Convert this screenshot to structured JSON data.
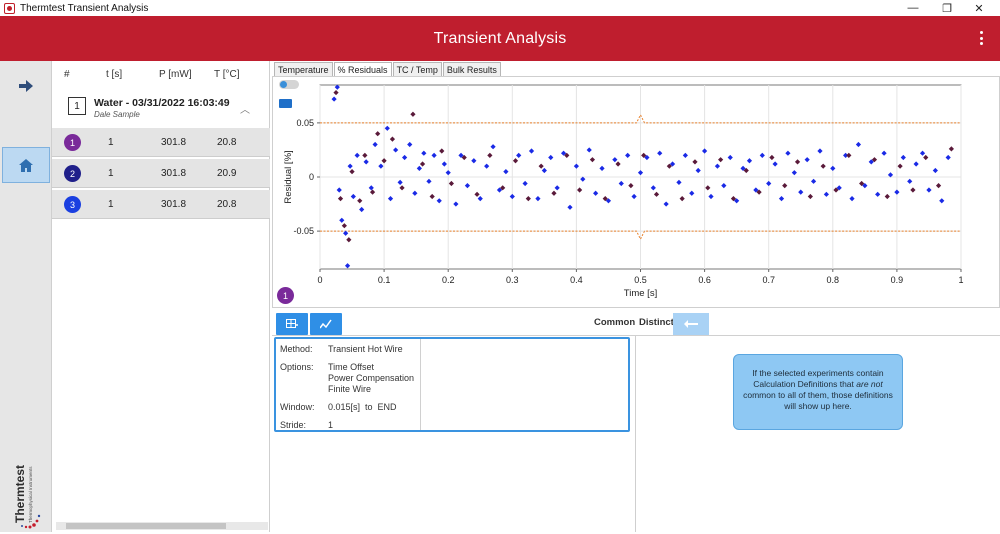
{
  "window": {
    "title": "Thermtest Transient Analysis",
    "minimize": "—",
    "maximize": "❐",
    "close": "✕"
  },
  "header": {
    "title": "Transient Analysis"
  },
  "rail": {
    "arrow_icon": "arrow-right-icon",
    "home_icon": "home-icon"
  },
  "brand": {
    "name": "Thermtest",
    "tagline": "Thermophysical Instruments"
  },
  "experiments": {
    "columns": [
      "#",
      "t [s]",
      "P [mW]",
      "T [°C]"
    ],
    "group": {
      "number": "1",
      "name": "Water - 03/31/2022 16:03:49",
      "sample": "Dale Sample"
    },
    "rows": [
      {
        "num": "1",
        "t": "1",
        "p": "301.8",
        "temp": "20.8",
        "color": "#7a2a9a"
      },
      {
        "num": "2",
        "t": "1",
        "p": "301.8",
        "temp": "20.9",
        "color": "#1f1f8a"
      },
      {
        "num": "3",
        "t": "1",
        "p": "301.8",
        "temp": "20.8",
        "color": "#1a3fe0"
      }
    ]
  },
  "tabs": [
    "Temperature",
    "% Residuals",
    "TC / Temp",
    "Bulk Results"
  ],
  "active_tab": "% Residuals",
  "chart_badge": "1",
  "chart_data": {
    "type": "scatter",
    "xlabel": "Time [s]",
    "ylabel": "Residual [%]",
    "xlim": [
      0,
      1
    ],
    "ylim": [
      -0.085,
      0.085
    ],
    "xticks": [
      "0",
      "0.1",
      "0.2",
      "0.3",
      "0.4",
      "0.5",
      "0.6",
      "0.7",
      "0.8",
      "0.9",
      "1"
    ],
    "yticks": [
      "0.05",
      "0",
      "-0.05"
    ],
    "grid": true,
    "limit_lines": [
      0.05,
      -0.05
    ],
    "series": [
      {
        "color": "#1a2ae6",
        "points": [
          [
            0.022,
            0.072
          ],
          [
            0.027,
            0.083
          ],
          [
            0.03,
            -0.012
          ],
          [
            0.034,
            -0.04
          ],
          [
            0.04,
            -0.052
          ],
          [
            0.043,
            -0.082
          ],
          [
            0.047,
            0.01
          ],
          [
            0.052,
            -0.018
          ],
          [
            0.058,
            0.02
          ],
          [
            0.065,
            -0.03
          ],
          [
            0.072,
            0.014
          ],
          [
            0.08,
            -0.01
          ],
          [
            0.086,
            0.03
          ],
          [
            0.095,
            0.01
          ],
          [
            0.105,
            0.045
          ],
          [
            0.11,
            -0.02
          ],
          [
            0.118,
            0.025
          ],
          [
            0.125,
            -0.005
          ],
          [
            0.132,
            0.018
          ],
          [
            0.14,
            0.03
          ],
          [
            0.148,
            -0.015
          ],
          [
            0.155,
            0.008
          ],
          [
            0.162,
            0.022
          ],
          [
            0.17,
            -0.004
          ],
          [
            0.178,
            0.02
          ],
          [
            0.186,
            -0.022
          ],
          [
            0.194,
            0.012
          ],
          [
            0.2,
            0.004
          ],
          [
            0.212,
            -0.025
          ],
          [
            0.22,
            0.02
          ],
          [
            0.23,
            -0.008
          ],
          [
            0.24,
            0.015
          ],
          [
            0.25,
            -0.02
          ],
          [
            0.26,
            0.01
          ],
          [
            0.27,
            0.028
          ],
          [
            0.28,
            -0.012
          ],
          [
            0.29,
            0.005
          ],
          [
            0.3,
            -0.018
          ],
          [
            0.31,
            0.02
          ],
          [
            0.32,
            -0.006
          ],
          [
            0.33,
            0.024
          ],
          [
            0.34,
            -0.02
          ],
          [
            0.35,
            0.006
          ],
          [
            0.36,
            0.018
          ],
          [
            0.37,
            -0.01
          ],
          [
            0.38,
            0.022
          ],
          [
            0.39,
            -0.028
          ],
          [
            0.4,
            0.01
          ],
          [
            0.41,
            -0.002
          ],
          [
            0.42,
            0.025
          ],
          [
            0.43,
            -0.015
          ],
          [
            0.44,
            0.008
          ],
          [
            0.45,
            -0.022
          ],
          [
            0.46,
            0.016
          ],
          [
            0.47,
            -0.006
          ],
          [
            0.48,
            0.02
          ],
          [
            0.49,
            -0.018
          ],
          [
            0.5,
            0.004
          ],
          [
            0.51,
            0.018
          ],
          [
            0.52,
            -0.01
          ],
          [
            0.53,
            0.022
          ],
          [
            0.54,
            -0.025
          ],
          [
            0.55,
            0.012
          ],
          [
            0.56,
            -0.005
          ],
          [
            0.57,
            0.02
          ],
          [
            0.58,
            -0.015
          ],
          [
            0.59,
            0.006
          ],
          [
            0.6,
            0.024
          ],
          [
            0.61,
            -0.018
          ],
          [
            0.62,
            0.01
          ],
          [
            0.63,
            -0.008
          ],
          [
            0.64,
            0.018
          ],
          [
            0.65,
            -0.022
          ],
          [
            0.66,
            0.008
          ],
          [
            0.67,
            0.015
          ],
          [
            0.68,
            -0.012
          ],
          [
            0.69,
            0.02
          ],
          [
            0.7,
            -0.006
          ],
          [
            0.71,
            0.012
          ],
          [
            0.72,
            -0.02
          ],
          [
            0.73,
            0.022
          ],
          [
            0.74,
            0.004
          ],
          [
            0.75,
            -0.014
          ],
          [
            0.76,
            0.016
          ],
          [
            0.77,
            -0.004
          ],
          [
            0.78,
            0.024
          ],
          [
            0.79,
            -0.016
          ],
          [
            0.8,
            0.008
          ],
          [
            0.81,
            -0.01
          ],
          [
            0.82,
            0.02
          ],
          [
            0.83,
            -0.02
          ],
          [
            0.84,
            0.03
          ],
          [
            0.85,
            -0.008
          ],
          [
            0.86,
            0.014
          ],
          [
            0.87,
            -0.016
          ],
          [
            0.88,
            0.022
          ],
          [
            0.89,
            0.002
          ],
          [
            0.9,
            -0.014
          ],
          [
            0.91,
            0.018
          ],
          [
            0.92,
            -0.004
          ],
          [
            0.93,
            0.012
          ],
          [
            0.94,
            0.022
          ],
          [
            0.95,
            -0.012
          ],
          [
            0.96,
            0.006
          ],
          [
            0.97,
            -0.022
          ],
          [
            0.98,
            0.018
          ]
        ]
      },
      {
        "color": "#5a1a3a",
        "points": [
          [
            0.025,
            0.078
          ],
          [
            0.032,
            -0.02
          ],
          [
            0.038,
            -0.045
          ],
          [
            0.045,
            -0.058
          ],
          [
            0.05,
            0.005
          ],
          [
            0.062,
            -0.022
          ],
          [
            0.07,
            0.02
          ],
          [
            0.082,
            -0.014
          ],
          [
            0.09,
            0.04
          ],
          [
            0.1,
            0.015
          ],
          [
            0.113,
            0.035
          ],
          [
            0.128,
            -0.01
          ],
          [
            0.145,
            0.058
          ],
          [
            0.16,
            0.012
          ],
          [
            0.175,
            -0.018
          ],
          [
            0.19,
            0.024
          ],
          [
            0.205,
            -0.006
          ],
          [
            0.225,
            0.018
          ],
          [
            0.245,
            -0.016
          ],
          [
            0.265,
            0.02
          ],
          [
            0.285,
            -0.01
          ],
          [
            0.305,
            0.015
          ],
          [
            0.325,
            -0.02
          ],
          [
            0.345,
            0.01
          ],
          [
            0.365,
            -0.015
          ],
          [
            0.385,
            0.02
          ],
          [
            0.405,
            -0.012
          ],
          [
            0.425,
            0.016
          ],
          [
            0.445,
            -0.02
          ],
          [
            0.465,
            0.012
          ],
          [
            0.485,
            -0.008
          ],
          [
            0.505,
            0.02
          ],
          [
            0.525,
            -0.016
          ],
          [
            0.545,
            0.01
          ],
          [
            0.565,
            -0.02
          ],
          [
            0.585,
            0.014
          ],
          [
            0.605,
            -0.01
          ],
          [
            0.625,
            0.016
          ],
          [
            0.645,
            -0.02
          ],
          [
            0.665,
            0.006
          ],
          [
            0.685,
            -0.014
          ],
          [
            0.705,
            0.018
          ],
          [
            0.725,
            -0.008
          ],
          [
            0.745,
            0.014
          ],
          [
            0.765,
            -0.018
          ],
          [
            0.785,
            0.01
          ],
          [
            0.805,
            -0.012
          ],
          [
            0.825,
            0.02
          ],
          [
            0.845,
            -0.006
          ],
          [
            0.865,
            0.016
          ],
          [
            0.885,
            -0.018
          ],
          [
            0.905,
            0.01
          ],
          [
            0.925,
            -0.012
          ],
          [
            0.945,
            0.018
          ],
          [
            0.965,
            -0.008
          ],
          [
            0.985,
            0.026
          ]
        ]
      }
    ]
  },
  "lower": {
    "common_label": "Common",
    "distinct_label": "Distinct",
    "method_label": "Method:",
    "method_value": "Transient Hot Wire",
    "options_label": "Options:",
    "options": [
      "Time Offset",
      "Power Compensation",
      "Finite Wire"
    ],
    "window_label": "Window:",
    "window_value": "0.015[s]  to  END",
    "stride_label": "Stride:",
    "stride_value": "1",
    "info_text": "If the selected experiments contain Calculation Definitions that are not common to all of them, those definitions will show up here."
  }
}
